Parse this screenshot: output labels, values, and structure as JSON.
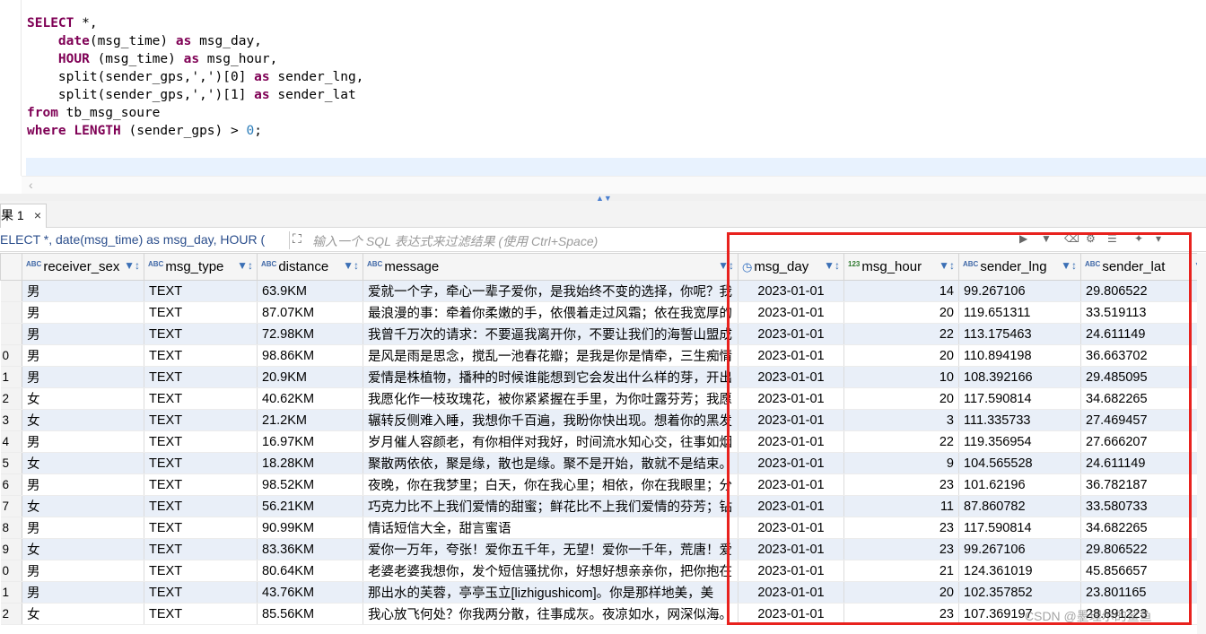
{
  "editor": {
    "lines": [
      {
        "kw": "SELECT",
        "rest": " *,"
      },
      {
        "indent": "    ",
        "kw": "date",
        "rest": "(msg_time) ",
        "kw2": "as",
        "rest2": " msg_day,"
      },
      {
        "indent": "    ",
        "kw": "HOUR",
        "rest": " (msg_time) ",
        "kw2": "as",
        "rest2": " msg_hour,"
      },
      {
        "indent": "    ",
        "kw": "",
        "rest": "split(sender_gps,',')[0] ",
        "kw2": "as",
        "rest2": " sender_lng,"
      },
      {
        "indent": "    ",
        "kw": "",
        "rest": "split(sender_gps,',')[1] ",
        "kw2": "as",
        "rest2": " sender_lat"
      },
      {
        "kw": "from",
        "rest": " tb_msg_soure"
      },
      {
        "kw": "where",
        "rest": " ",
        "kw2": "LENGTH",
        "rest2": " (sender_gps) > ",
        "num": "0",
        "tail": ";"
      }
    ]
  },
  "results": {
    "tab_label": "果 1",
    "tab_close": "×",
    "query_text": "ELECT *, date(msg_time) as msg_day, HOUR (",
    "filter_placeholder": "输入一个 SQL 表达式来过滤结果 (使用 Ctrl+Space)",
    "columns": [
      {
        "label": "receiver_sex",
        "type": "ABC"
      },
      {
        "label": "msg_type",
        "type": "ABC"
      },
      {
        "label": "distance",
        "type": "ABC"
      },
      {
        "label": "message",
        "type": "ABC"
      },
      {
        "label": "msg_day",
        "type": "date"
      },
      {
        "label": "msg_hour",
        "type": "123"
      },
      {
        "label": "sender_lng",
        "type": "ABC"
      },
      {
        "label": "sender_lat",
        "type": "ABC"
      }
    ],
    "rows": [
      {
        "rn": "",
        "sex": "男",
        "type": "TEXT",
        "dist": "63.9KM",
        "msg": "爱就一个字，牵心一辈子爱你，是我始终不变的选择，你呢？我",
        "day": "2023-01-01",
        "hour": "14",
        "lng": "99.267106",
        "lat": "29.806522"
      },
      {
        "rn": "",
        "sex": "男",
        "type": "TEXT",
        "dist": "87.07KM",
        "msg": "最浪漫的事：牵着你柔嫩的手，依偎着走过风霜；依在我宽厚的",
        "day": "2023-01-01",
        "hour": "20",
        "lng": "119.651311",
        "lat": "33.519113"
      },
      {
        "rn": "",
        "sex": "男",
        "type": "TEXT",
        "dist": "72.98KM",
        "msg": "我曾千万次的请求：不要逼我离开你，不要让我们的海誓山盟成",
        "day": "2023-01-01",
        "hour": "22",
        "lng": "113.175463",
        "lat": "24.611149"
      },
      {
        "rn": "0",
        "sex": "男",
        "type": "TEXT",
        "dist": "98.86KM",
        "msg": "是风是雨是思念，搅乱一池春花瓣；是我是你是情牵，三生痴情",
        "day": "2023-01-01",
        "hour": "20",
        "lng": "110.894198",
        "lat": "36.663702"
      },
      {
        "rn": "1",
        "sex": "男",
        "type": "TEXT",
        "dist": "20.9KM",
        "msg": "爱情是株植物，播种的时候谁能想到它会发出什么样的芽，开出",
        "day": "2023-01-01",
        "hour": "10",
        "lng": "108.392166",
        "lat": "29.485095"
      },
      {
        "rn": "2",
        "sex": "女",
        "type": "TEXT",
        "dist": "40.62KM",
        "msg": "我愿化作一枝玫瑰花，被你紧紧握在手里，为你吐露芬芳；我愿",
        "day": "2023-01-01",
        "hour": "20",
        "lng": "117.590814",
        "lat": "34.682265"
      },
      {
        "rn": "3",
        "sex": "女",
        "type": "TEXT",
        "dist": "21.2KM",
        "msg": "辗转反侧难入睡，我想你千百遍，我盼你快出现。想着你的黑发",
        "day": "2023-01-01",
        "hour": "3",
        "lng": "111.335733",
        "lat": "27.469457"
      },
      {
        "rn": "4",
        "sex": "男",
        "type": "TEXT",
        "dist": "16.97KM",
        "msg": "岁月催人容颜老，有你相伴对我好，时间流水知心交，往事如烟",
        "day": "2023-01-01",
        "hour": "22",
        "lng": "119.356954",
        "lat": "27.666207"
      },
      {
        "rn": "5",
        "sex": "女",
        "type": "TEXT",
        "dist": "18.28KM",
        "msg": "聚散两依依，聚是缘，散也是缘。聚不是开始，散就不是结束。",
        "day": "2023-01-01",
        "hour": "9",
        "lng": "104.565528",
        "lat": "24.611149"
      },
      {
        "rn": "6",
        "sex": "男",
        "type": "TEXT",
        "dist": "98.52KM",
        "msg": "夜晚，你在我梦里；白天，你在我心里；相依，你在我眼里；分",
        "day": "2023-01-01",
        "hour": "23",
        "lng": "101.62196",
        "lat": "36.782187"
      },
      {
        "rn": "7",
        "sex": "女",
        "type": "TEXT",
        "dist": "56.21KM",
        "msg": "巧克力比不上我们爱情的甜蜜；鲜花比不上我们爱情的芬芳；钻",
        "day": "2023-01-01",
        "hour": "11",
        "lng": "87.860782",
        "lat": "33.580733"
      },
      {
        "rn": "8",
        "sex": "男",
        "type": "TEXT",
        "dist": "90.99KM",
        "msg": "情话短信大全，甜言蜜语",
        "day": "2023-01-01",
        "hour": "23",
        "lng": "117.590814",
        "lat": "34.682265"
      },
      {
        "rn": "9",
        "sex": "女",
        "type": "TEXT",
        "dist": "83.36KM",
        "msg": "爱你一万年，夸张！爱你五千年，无望！爱你一千年，荒唐！爱",
        "day": "2023-01-01",
        "hour": "23",
        "lng": "99.267106",
        "lat": "29.806522"
      },
      {
        "rn": "0",
        "sex": "男",
        "type": "TEXT",
        "dist": "80.64KM",
        "msg": "老婆老婆我想你，发个短信骚扰你，好想好想亲亲你，把你抱在",
        "day": "2023-01-01",
        "hour": "21",
        "lng": "124.361019",
        "lat": "45.856657"
      },
      {
        "rn": "1",
        "sex": "男",
        "type": "TEXT",
        "dist": "43.76KM",
        "msg": "那出水的芙蓉，亭亭玉立[lizhigushicom]。你是那样地美，美",
        "day": "2023-01-01",
        "hour": "20",
        "lng": "102.357852",
        "lat": "23.801165"
      },
      {
        "rn": "2",
        "sex": "女",
        "type": "TEXT",
        "dist": "85.56KM",
        "msg": "我心放飞何处？你我两分散，往事成灰。夜凉如水，网深似海。",
        "day": "2023-01-01",
        "hour": "23",
        "lng": "107.369197",
        "lat": "28.891223"
      }
    ]
  },
  "watermark": "CSDN @墨理尔的鲨鱼",
  "colors": {
    "highlight": "#e8221e",
    "keyword": "#7f0055",
    "alt_row": "#e9eff8"
  }
}
